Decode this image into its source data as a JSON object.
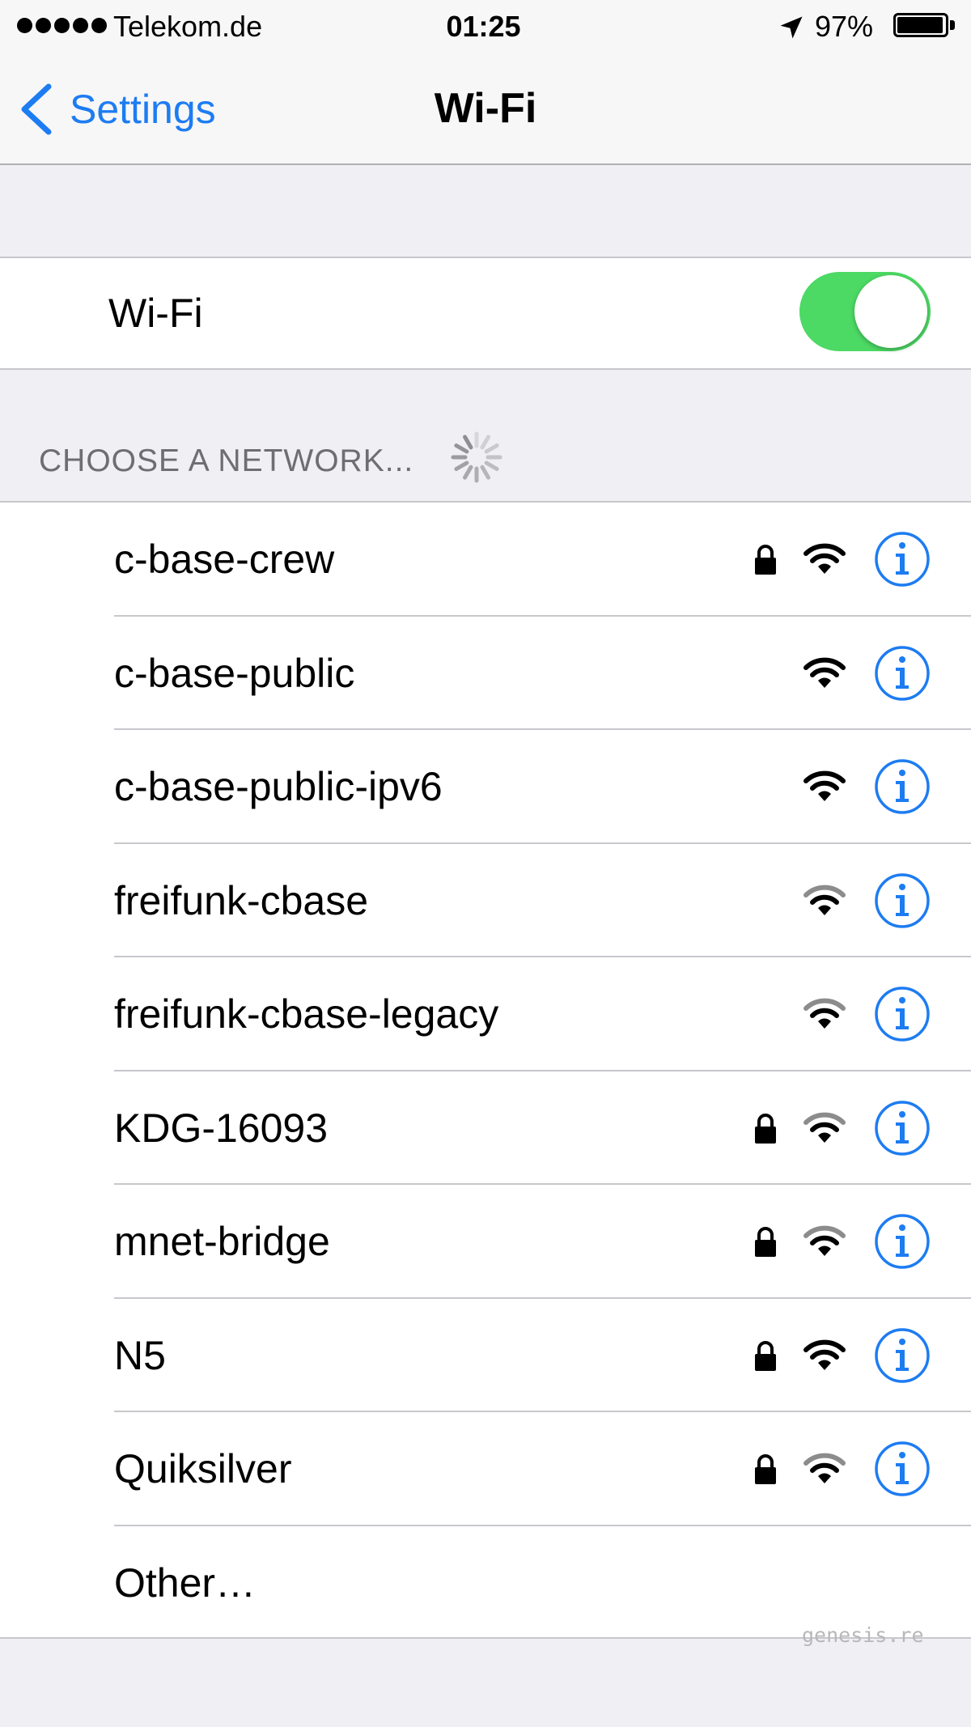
{
  "status_bar": {
    "carrier": "Telekom.de",
    "time": "01:25",
    "battery_percent": "97%",
    "battery_level": 0.97,
    "signal_bars": 5
  },
  "nav": {
    "back_label": "Settings",
    "title": "Wi-Fi"
  },
  "wifi_toggle": {
    "label": "Wi-Fi",
    "state": "on",
    "on_color": "#4cd964"
  },
  "section": {
    "header": "CHOOSE A NETWORK..."
  },
  "networks": [
    {
      "name": "c-base-crew",
      "locked": true,
      "strength": "strong"
    },
    {
      "name": "c-base-public",
      "locked": false,
      "strength": "strong"
    },
    {
      "name": "c-base-public-ipv6",
      "locked": false,
      "strength": "strong"
    },
    {
      "name": "freifunk-cbase",
      "locked": false,
      "strength": "weak"
    },
    {
      "name": "freifunk-cbase-legacy",
      "locked": false,
      "strength": "weak"
    },
    {
      "name": "KDG-16093",
      "locked": true,
      "strength": "weak"
    },
    {
      "name": "mnet-bridge",
      "locked": true,
      "strength": "weak"
    },
    {
      "name": "N5",
      "locked": true,
      "strength": "strong"
    },
    {
      "name": "Quiksilver",
      "locked": true,
      "strength": "weak"
    }
  ],
  "other": {
    "label": "Other…"
  },
  "watermark": "genesis.re",
  "colors": {
    "accent_blue": "#1d7cf2",
    "background": "#efeff4",
    "section_header": "#6d6d72"
  },
  "icons": {
    "back": "chevron-left-icon",
    "lock": "lock-icon",
    "wifi": "wifi-signal-icon",
    "info": "info-icon",
    "location": "location-arrow-icon",
    "spinner": "loading-spinner-icon"
  }
}
